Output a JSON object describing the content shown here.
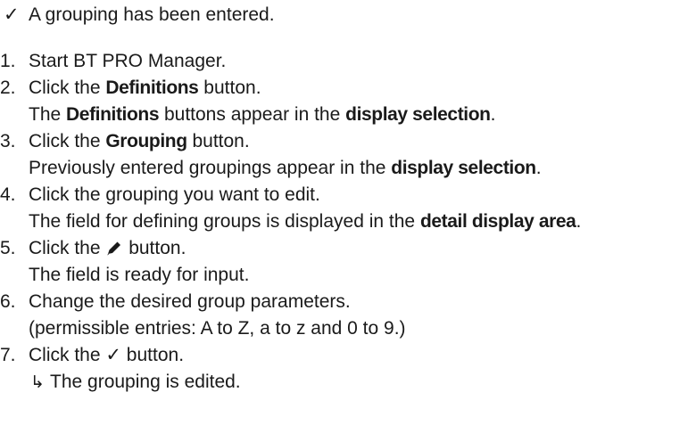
{
  "prerequisite": {
    "icon": "check-icon",
    "mark": "✓",
    "text": "A grouping has been entered."
  },
  "steps": [
    {
      "num": "1.",
      "parts": [
        "Start BT PRO Manager."
      ]
    },
    {
      "num": "2.",
      "line1_a": "Click the ",
      "line1_b": "Definitions",
      "line1_c": " button.",
      "line2_a": "The ",
      "line2_b": "Definitions",
      "line2_c": " buttons appear in the ",
      "line2_d": "display selection",
      "line2_e": "."
    },
    {
      "num": "3.",
      "line1_a": "Click the ",
      "line1_b": "Grouping",
      "line1_c": " button.",
      "line2_a": "Previously entered groupings appear in the ",
      "line2_b": "display selection",
      "line2_c": "."
    },
    {
      "num": "4.",
      "line1": "Click the grouping you want to edit.",
      "line2_a": "The field for defining groups is displayed in the ",
      "line2_b": "detail display area",
      "line2_c": "."
    },
    {
      "num": "5.",
      "line1_a": "Click the ",
      "line1_icon": "pencil-icon",
      "line1_c": " button.",
      "line2": "The field is ready for input."
    },
    {
      "num": "6.",
      "line1": "Change the desired group parameters.",
      "line2": "(permissible entries: A to Z, a to z and 0 to 9.)"
    },
    {
      "num": "7.",
      "line1_a": "Click the ",
      "line1_icon_mark": "✓",
      "line1_c": " button.",
      "result_arrow": "↳",
      "result": "The grouping is edited."
    }
  ]
}
